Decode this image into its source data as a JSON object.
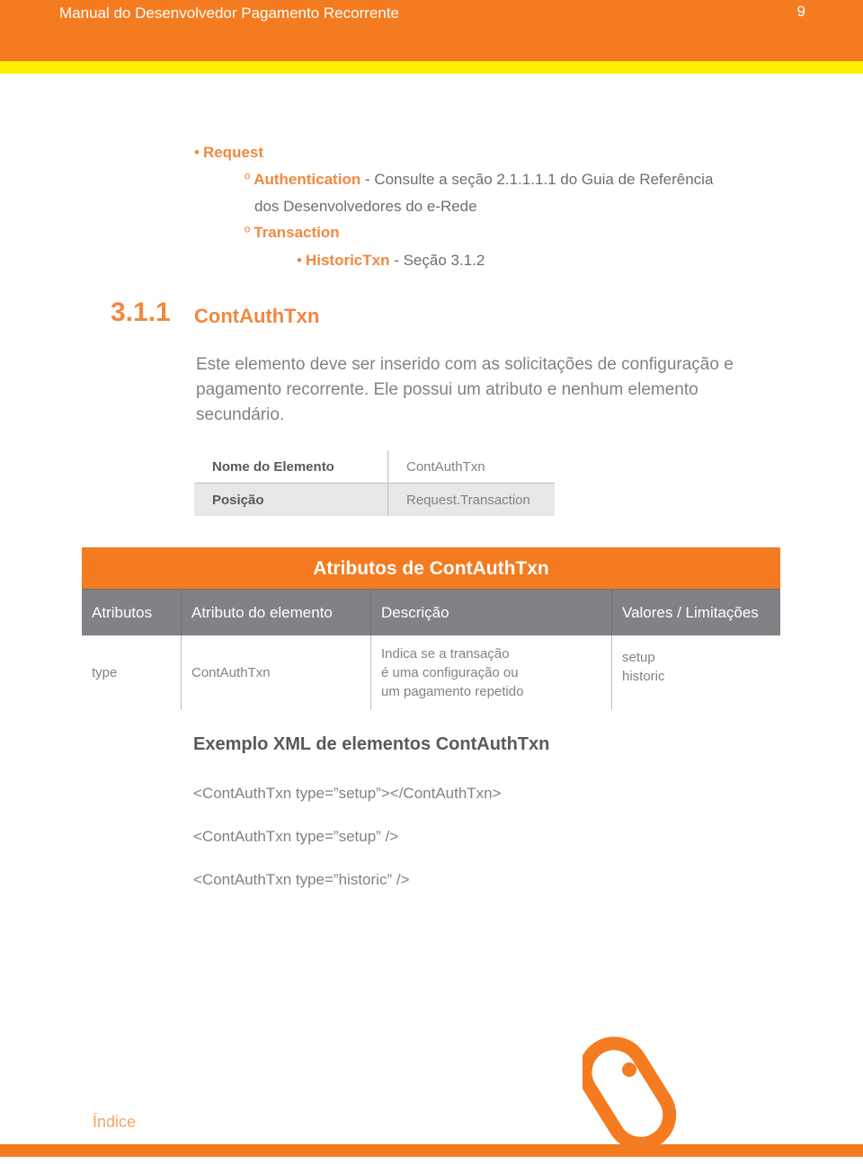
{
  "header": {
    "title": "Manual do Desenvolvedor Pagamento Recorrente",
    "page_number": "9"
  },
  "outline": {
    "request": {
      "bullet": "•",
      "label": "Request"
    },
    "authentication": {
      "bullet": "º",
      "label": "Authentication",
      "text_line1": " - Consulte a seção 2.1.1.1.1 do Guia de Referência",
      "text_line2": "dos Desenvolvedores do e-Rede"
    },
    "transaction": {
      "bullet": "º",
      "label": "Transaction"
    },
    "historic": {
      "bullet": "•",
      "label": "HistoricTxn",
      "text": " - Seção 3.1.2"
    }
  },
  "section": {
    "number": "3.1.1",
    "title": "ContAuthTxn",
    "description": "Este elemento deve ser inserido com as solicitações de configuração e pagamento recorrente. Ele possui um atributo e nenhum elemento secundário."
  },
  "element_info": [
    {
      "key": "Nome do Elemento",
      "value": "ContAuthTxn"
    },
    {
      "key": "Posição",
      "value": "Request.Transaction"
    }
  ],
  "attributes_table": {
    "title": "Atributos de ContAuthTxn",
    "headers": [
      "Atributos",
      "Atributo do elemento",
      "Descrição",
      "Valores / Limitações"
    ],
    "rows": [
      {
        "attribute": "type",
        "element_attribute": "ContAuthTxn",
        "description": [
          "Indica se a transação",
          "é uma configuração ou",
          "um pagamento repetido"
        ],
        "values": [
          "setup",
          "historic"
        ]
      }
    ]
  },
  "xml_example": {
    "title": "Exemplo XML de elementos ContAuthTxn",
    "lines": [
      "<ContAuthTxn type=”setup”></ContAuthTxn>",
      "<ContAuthTxn type=”setup” />",
      "<ContAuthTxn type=”historic” />"
    ]
  },
  "footer": {
    "index_link": "Índice",
    "icon": "mouse-icon"
  },
  "colors": {
    "brand_orange": "#f47b20",
    "accent_yellow": "#ffed00",
    "header_gray": "#808285"
  }
}
